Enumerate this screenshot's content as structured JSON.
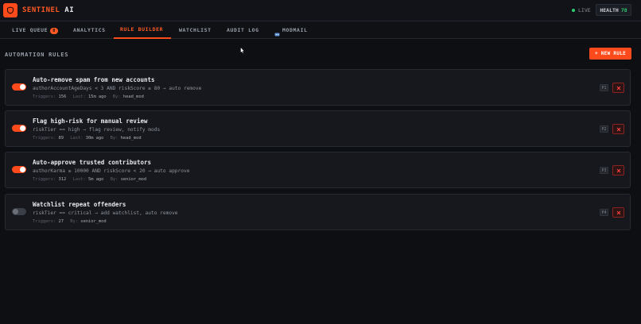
{
  "brand": {
    "name_accent": "SENTINEL",
    "name_rest": "AI"
  },
  "status": {
    "live_label": "LIVE",
    "health_label": "HEALTH",
    "health_value": "78"
  },
  "tabs": [
    {
      "label": "LIVE QUEUE",
      "badge": "8"
    },
    {
      "label": "ANALYTICS"
    },
    {
      "label": "RULE BUILDER"
    },
    {
      "label": "WATCHLIST"
    },
    {
      "label": "AUDIT LOG"
    },
    {
      "label": "MODMAIL"
    }
  ],
  "section": {
    "title": "AUTOMATION RULES",
    "new_rule_label": "+ NEW RULE"
  },
  "meta_labels": {
    "triggers": "Triggers:",
    "last": "Last:",
    "by": "By:"
  },
  "rules": [
    {
      "name": "Auto-remove spam from new accounts",
      "condition": "authorAccountAgeDays < 3 AND riskScore ≥ 80 → auto remove",
      "triggers": "156",
      "last": "15m ago",
      "by": "head_mod",
      "priority": "P1",
      "enabled": true
    },
    {
      "name": "Flag high-risk for manual review",
      "condition": "riskTier == high → flag review, notify mods",
      "triggers": "89",
      "last": "30m ago",
      "by": "head_mod",
      "priority": "P2",
      "enabled": true
    },
    {
      "name": "Auto-approve trusted contributors",
      "condition": "authorKarma ≥ 10000 AND riskScore < 20 → auto approve",
      "triggers": "312",
      "last": "5m ago",
      "by": "senior_mod",
      "priority": "P3",
      "enabled": true
    },
    {
      "name": "Watchlist repeat offenders",
      "condition": "riskTier == critical → add watchlist, auto remove",
      "triggers": "27",
      "by": "senior_mod",
      "priority": "P4",
      "enabled": false
    }
  ],
  "colors": {
    "accent": "#ff4a1c",
    "live": "#2ecc71",
    "danger": "#8b2323"
  }
}
